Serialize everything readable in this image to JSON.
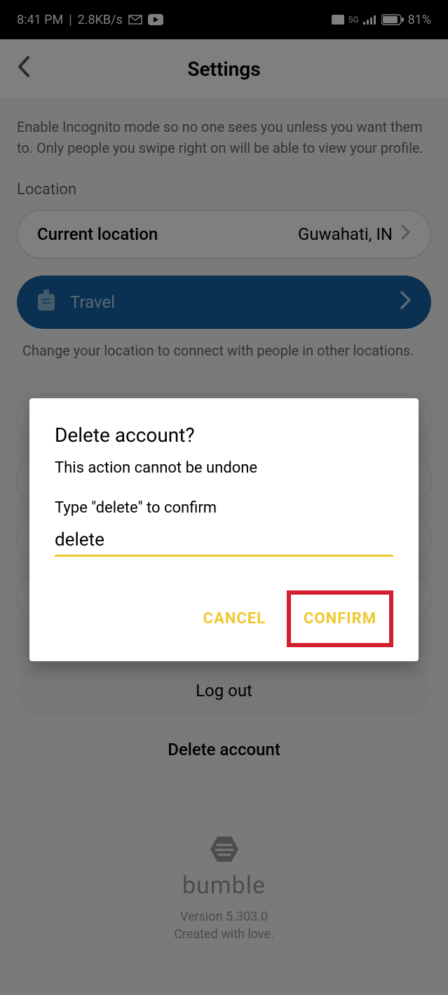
{
  "status": {
    "time": "8:41 PM",
    "speed": "2.8KB/s",
    "network": "5G",
    "battery": "81%"
  },
  "header": {
    "title": "Settings"
  },
  "incognito": {
    "description": "Enable Incognito mode so no one sees you unless you want them to. Only people you swipe right on will be able to view your profile."
  },
  "location": {
    "section_label": "Location",
    "row_label": "Current location",
    "row_value": "Guwahati, IN"
  },
  "travel": {
    "label": "Travel",
    "hint": "Change your location to connect with people in other locations."
  },
  "logout": {
    "label": "Log out"
  },
  "delete_account": {
    "label": "Delete account"
  },
  "footer": {
    "brand": "bumble",
    "version": "Version 5.303.0",
    "created": "Created with love."
  },
  "dialog": {
    "title": "Delete account?",
    "subtitle": "This action cannot be undone",
    "prompt": "Type \"delete\" to confirm",
    "input_value": "delete",
    "cancel": "CANCEL",
    "confirm": "CONFIRM"
  }
}
